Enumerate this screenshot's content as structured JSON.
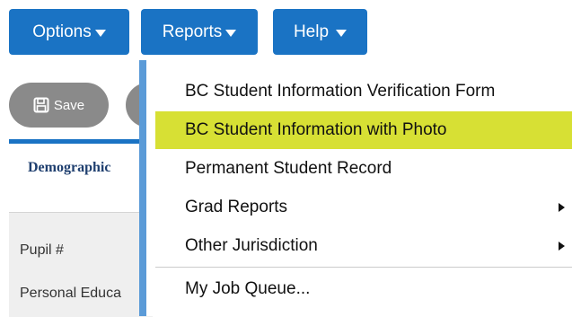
{
  "toolbar": {
    "options_label": "Options",
    "reports_label": "Reports",
    "help_label": "Help",
    "save_label": "Save"
  },
  "tabs": {
    "demographics_label": "Demographic"
  },
  "fields": {
    "pupil_label": "Pupil #",
    "personal_education_label": "Personal Educa"
  },
  "reports_menu": {
    "items": [
      {
        "label": "BC Student Information Verification Form"
      },
      {
        "label": "BC Student Information with Photo",
        "highlighted": true
      },
      {
        "label": "Permanent Student Record"
      },
      {
        "label": "Grad Reports",
        "has_submenu": true
      },
      {
        "label": "Other Jurisdiction",
        "has_submenu": true
      },
      {
        "label": "My Job Queue..."
      }
    ]
  },
  "colors": {
    "button_blue": "#1a73c4",
    "menu_border": "#5b9bd8",
    "highlight": "#d7e034",
    "save_gray": "#8a8a8a"
  },
  "icons": {
    "save": "floppy-disk-icon",
    "dropdown": "caret-down-icon",
    "submenu": "caret-right-icon"
  }
}
